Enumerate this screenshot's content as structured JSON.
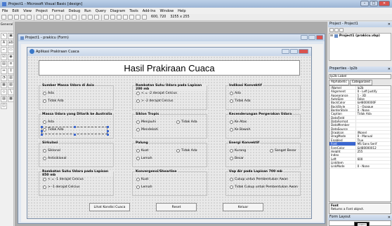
{
  "ide": {
    "title": "Project1 - Microsoft Visual Basic [design]",
    "menu": [
      "File",
      "Edit",
      "View",
      "Project",
      "Format",
      "Debug",
      "Run",
      "Query",
      "Diagram",
      "Tools",
      "Add-Ins",
      "Window",
      "Help"
    ],
    "toolbar_pos": "600, 720",
    "toolbar_size": "3255 x 255"
  },
  "toolbox": {
    "title": "General"
  },
  "child_window": {
    "title": "Project1 - prakicu (Form)"
  },
  "form": {
    "title": "Aplikasi Prakiraan Cuaca",
    "headline": "Hasil Prakiraan Cuaca",
    "groups": [
      {
        "title": "Sumber Massa Udara di Asia",
        "options": [
          "Ada",
          "Tidak Ada"
        ]
      },
      {
        "title": "Rambatan Suhu Udara pada Lapisan 200 mb",
        "options": [
          "< = -2 derajat Celcius",
          "> -2 derajat Celcius"
        ]
      },
      {
        "title": "Indikasi Konvektif",
        "options": [
          "Ada",
          "Tidak Ada"
        ]
      },
      {
        "title": "Massa Udara yang Ditarik ke Australia",
        "options": [
          "Ada",
          "Tidak Ada"
        ]
      },
      {
        "title": "Siklon Tropis",
        "options": [
          "Menjauhi",
          "Mendekati",
          "Tidak Ada"
        ]
      },
      {
        "title": "Kecenderungan Pergerakan Udara",
        "options": [
          "Ke Atas",
          "Ke Bawah"
        ]
      },
      {
        "title": "Sirkulasi",
        "options": [
          "Siklonal",
          "Antisiklonal"
        ]
      },
      {
        "title": "Palung",
        "options": [
          "Kuat",
          "Lemah",
          "Tidak Ada"
        ]
      },
      {
        "title": "Energi Konvektif",
        "options": [
          "Kurang",
          "Besar",
          "Sangat Besar"
        ]
      },
      {
        "title": "Rambatan Suhu Udara pada Lapisan 850 mb",
        "options": [
          "< = -1 derajat Celcius",
          "> -1 derajat Celcius"
        ]
      },
      {
        "title": "Konvergensi/Shearline",
        "options": [
          "Kuat",
          "Lemah"
        ]
      },
      {
        "title": "Uap Air pada Lapisan 700 mb",
        "options": [
          "Cukup untuk Pembentukan Awan",
          "Tidak Cukup untuk Pembentukan Awan"
        ]
      }
    ],
    "buttons": {
      "lihat": "Lihat Kondisi Cuaca",
      "reset": "Reset",
      "keluar": "Keluar"
    }
  },
  "project_panel": {
    "title": "Project - Project1",
    "tree": "Project1 (prakicu.vbp)"
  },
  "properties_panel": {
    "title": "Properties - lp2b",
    "object": "lp2b Label",
    "tab_alpha": "Alphabetic",
    "tab_cat": "Categorized",
    "rows": [
      [
        "(Name)",
        "lp2b"
      ],
      [
        "Alignment",
        "0 - Left Justify"
      ],
      [
        "Appearance",
        "1 - 3D"
      ],
      [
        "AutoSize",
        "False"
      ],
      [
        "BackColor",
        "&H8000000F"
      ],
      [
        "BackStyle",
        "1 - Opaque"
      ],
      [
        "BorderStyle",
        "0 - None"
      ],
      [
        "Caption",
        "Tidak Ada"
      ],
      [
        "DataField",
        ""
      ],
      [
        "DataFormat",
        ""
      ],
      [
        "DataMember",
        ""
      ],
      [
        "DataSource",
        ""
      ],
      [
        "DragIcon",
        "(None)"
      ],
      [
        "DragMode",
        "0 - Manual"
      ],
      [
        "Enabled",
        "True"
      ],
      [
        "Font",
        "MS Sans Serif"
      ],
      [
        "ForeColor",
        "&H80000012"
      ],
      [
        "Height",
        "255"
      ],
      [
        "Index",
        ""
      ],
      [
        "Left",
        "600"
      ],
      [
        "LinkItem",
        ""
      ],
      [
        "LinkMode",
        "0 - None"
      ]
    ],
    "desc_title": "Font",
    "desc_text": "Returns a Font object."
  },
  "layout_panel": {
    "title": "Form Layout",
    "mini_label": "prakicu"
  }
}
